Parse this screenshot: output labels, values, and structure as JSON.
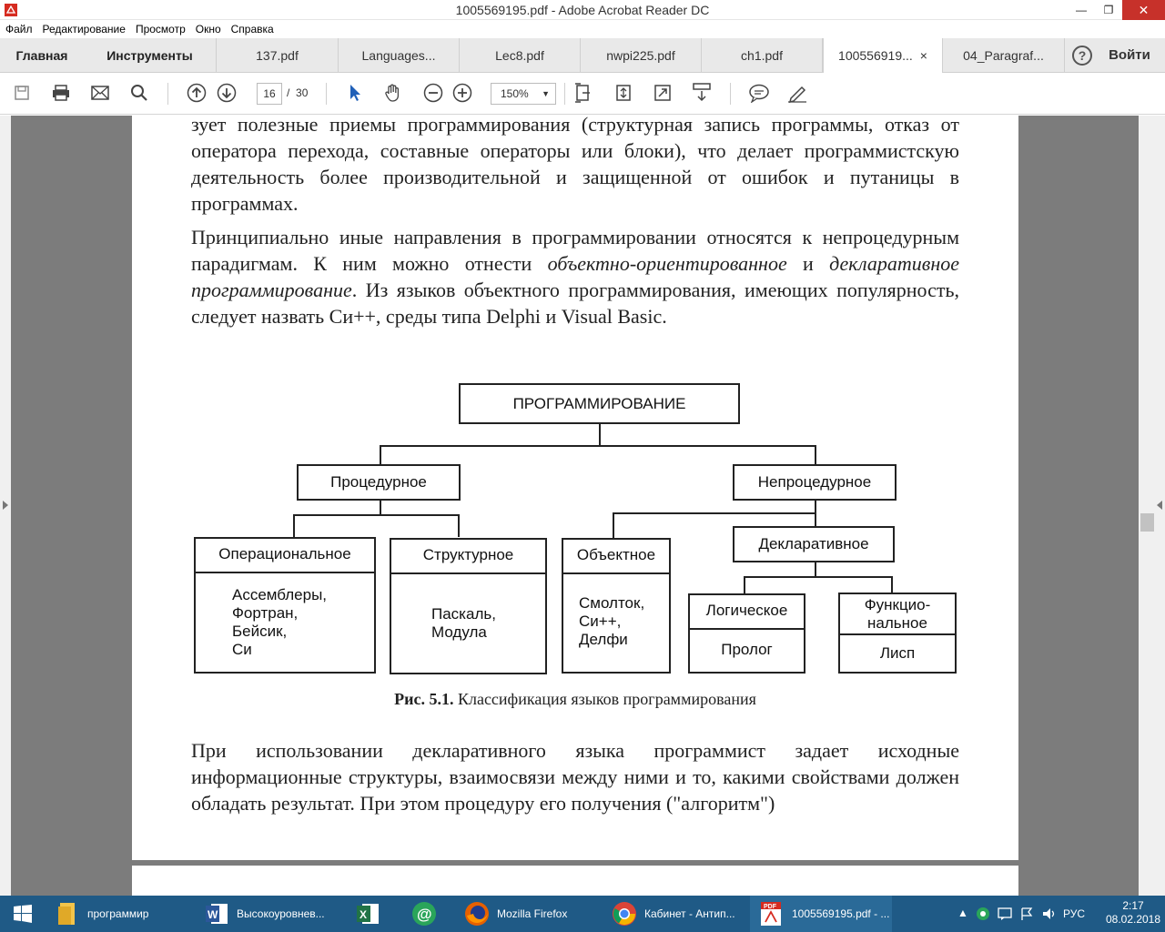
{
  "window": {
    "title": "1005569195.pdf - Adobe Acrobat Reader DC",
    "controls": {
      "minimize": "—",
      "maximize": "❐",
      "close": "✕"
    }
  },
  "menu": [
    "Файл",
    "Редактирование",
    "Просмотр",
    "Окно",
    "Справка"
  ],
  "tabs": {
    "home": "Главная",
    "tools": "Инструменты",
    "docs": [
      "137.pdf",
      "Languages...",
      "Lec8.pdf",
      "nwpi225.pdf",
      "ch1.pdf",
      "100556919...",
      "04_Paragraf..."
    ],
    "active_index": 5,
    "close_glyph": "×",
    "help": "?",
    "signin": "Войти"
  },
  "toolbar": {
    "page_current": "16",
    "page_separator": "/",
    "page_total": "30",
    "zoom": "150%",
    "icons": [
      "save-icon",
      "print-icon",
      "email-icon",
      "search-icon",
      "prev-page-icon",
      "next-page-icon",
      "select-cursor-icon",
      "hand-tool-icon",
      "zoom-out-icon",
      "zoom-in-icon",
      "fit-page-icon",
      "scroll-mode-icon",
      "full-screen-icon",
      "page-layout-icon",
      "comment-icon",
      "sign-icon"
    ]
  },
  "document": {
    "para1": "зует полезные приемы программирования (структурная запись программы, отказ от оператора перехода, составные операторы или блоки), что делает программистскую деятельность более производительной и защищенной от ошибок и путаницы в программах.",
    "para2_a": "Принципиально иные направления в программировании относятся к непроцедурным парадигмам. К ним можно отнести ",
    "para2_i1": "объектно-ориентированное",
    "para2_b": " и ",
    "para2_i2": "декларативное программирование",
    "para2_c": ". Из языков объектного программирования, имеющих популярность, следует назвать Си++, среды типа Delphi и Visual Basic.",
    "diagram": {
      "root": "ПРОГРАММИРОВАНИЕ",
      "proc": "Процедурное",
      "nonproc": "Непроцедурное",
      "oper": "Операциональное",
      "oper_langs": [
        "Ассемблеры,",
        "Фортран,",
        "Бейсик,",
        "Си"
      ],
      "struct": "Структурное",
      "struct_langs": [
        "Паскаль,",
        "Модула"
      ],
      "object": "Объектное",
      "object_langs": [
        "Смолток,",
        "Си++,",
        "Делфи"
      ],
      "decl": "Декларативное",
      "logic": "Логическое",
      "logic_langs": "Пролог",
      "func": [
        "Функцио-",
        "нальное"
      ],
      "func_langs": "Лисп"
    },
    "caption_bold": "Рис. 5.1.",
    "caption_text": " Классификация языков программирования",
    "para3": "При использовании декларативного языка программист задает исходные информационные структуры, взаимосвязи между ними и то, какими свойствами должен обладать результат. При этом процедуру его получения (\"алгоритм\")"
  },
  "taskbar": {
    "items": [
      {
        "label": "программир",
        "icon": "folder-icon"
      },
      {
        "label": "Высокоуровнев...",
        "icon": "word-icon"
      },
      {
        "label": "",
        "icon": "excel-icon"
      },
      {
        "label": "",
        "icon": "at-mail-icon"
      },
      {
        "label": "Mozilla Firefox",
        "icon": "firefox-icon"
      },
      {
        "label": "Кабинет - Антип...",
        "icon": "chrome-icon"
      },
      {
        "label": "1005569195.pdf - ...",
        "icon": "acrobat-icon"
      }
    ],
    "lang": "РУС",
    "time": "2:17",
    "date": "08.02.2018"
  },
  "colors": {
    "taskbar": "#1f5a86",
    "close_button": "#c7312a",
    "viewer_bg": "#7c7c7c"
  }
}
